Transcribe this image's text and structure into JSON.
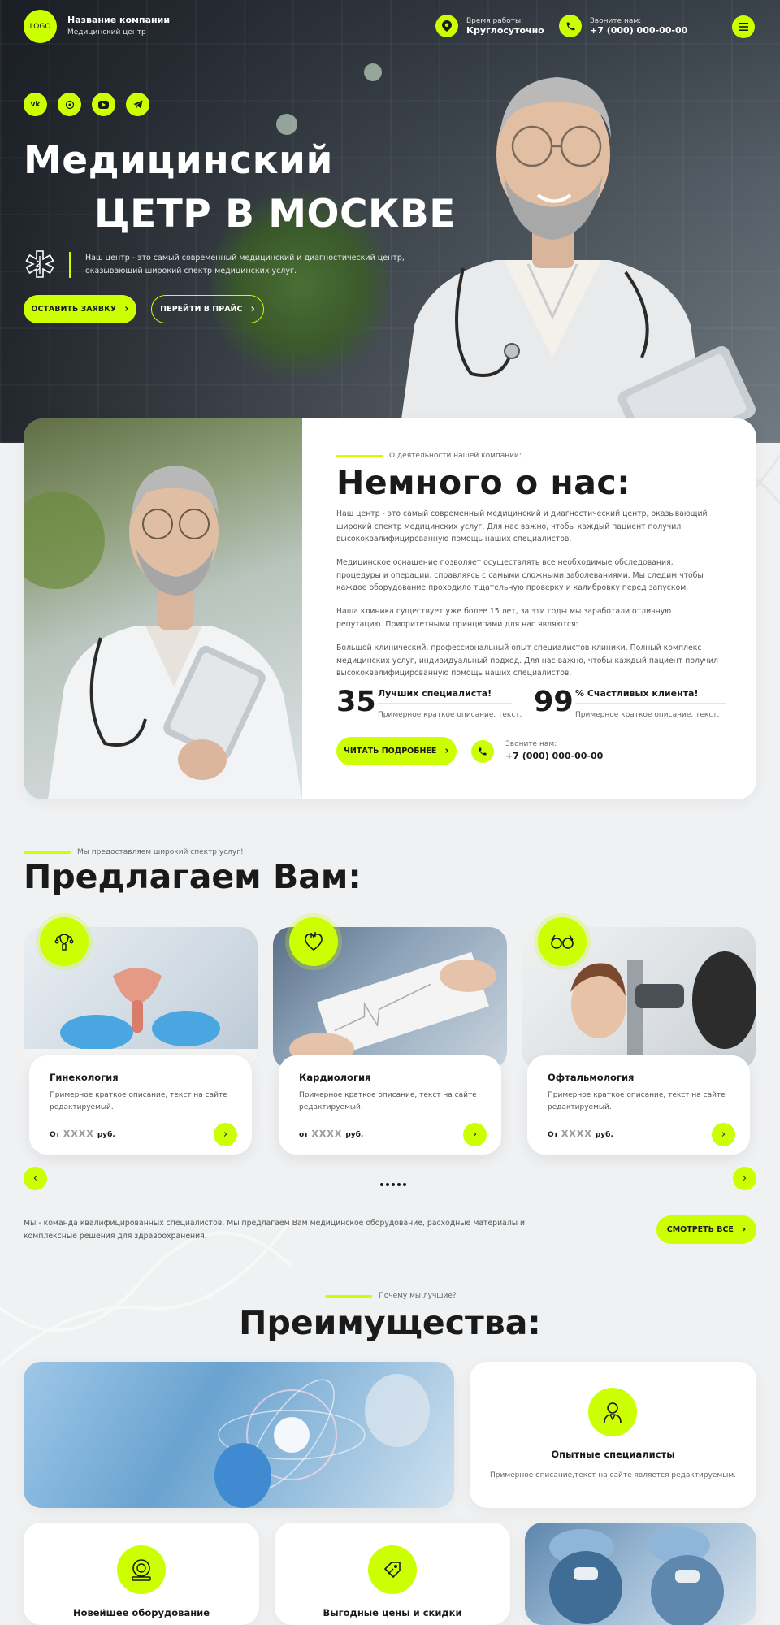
{
  "colors": {
    "accent": "#ccff00",
    "dark": "#1a1a1a",
    "bg": "#f0f1f2"
  },
  "header": {
    "logo": "LOGO",
    "company_name": "Название компании",
    "company_sub": "Медицинский центр",
    "hours_label": "Время работы:",
    "hours_value": "Круглосуточно",
    "phone_label": "Звоните нам:",
    "phone_value": "+7 (000) 000-00-00",
    "menu_icon": "menu-icon"
  },
  "social": [
    {
      "icon": "vk-icon",
      "label": "vk"
    },
    {
      "icon": "whatsapp-icon",
      "label": "wa"
    },
    {
      "icon": "youtube-icon",
      "label": "yt"
    },
    {
      "icon": "telegram-icon",
      "label": "tg"
    }
  ],
  "hero": {
    "title_line1": "Медицинский",
    "title_line2": "ЦЕТР В МОСКВЕ",
    "description": "Наш центр - это самый современный медицинский и диагностический центр, оказывающий широкий спектр медицинских услуг.",
    "btn_request": "ОСТАВИТЬ ЗАЯВКУ",
    "btn_price": "ПЕРЕЙТИ В ПРАЙС"
  },
  "about": {
    "kicker": "О деятельности нашей компании:",
    "title": "Немного о нас:",
    "p1": "Наш центр - это самый современный медицинский и диагностический центр, оказывающий широкий спектр медицинских услуг. Для нас важно, чтобы каждый пациент получил высококвалифицированную помощь наших специалистов.",
    "p2": "Медицинское оснащение позволяет осуществлять все необходимые обследования, процедуры и операции, справляясь с самыми сложными заболеваниями. Мы следим чтобы каждое оборудование проходило тщательную проверку и калибровку перед запуском.",
    "p3": "Наша клиника существует уже более 15 лет, за эти годы мы заработали отличную репутацию. Приоритетными принципами для нас являются:",
    "p4": "Большой клинический, профессиональный опыт специалистов клиники. Полный комплекс медицинских услуг, индивидуальный подход. Для нас важно, чтобы каждый пациент получил высококвалифицированную помощь наших специалистов.",
    "stats": [
      {
        "num": "35",
        "title": "Лучших специалиста!",
        "desc": "Примерное краткое описание, текст."
      },
      {
        "num": "99",
        "title": "% Счастливых клиента!",
        "desc": "Примерное краткое описание, текст."
      }
    ],
    "btn_more": "ЧИТАТЬ ПОДРОБНЕЕ",
    "phone_label": "Звоните нам:",
    "phone_value": "+7 (000) 000-00-00"
  },
  "services": {
    "kicker": "Мы предоставляем широкий спектр услуг!",
    "title": "Предлагаем Вам:",
    "items": [
      {
        "title": "Гинекология",
        "desc": "Примерное краткое описание, текст на сайте редактируемый.",
        "price_from": "От",
        "price": "XXXX",
        "currency": "руб.",
        "icon": "uterus-icon"
      },
      {
        "title": "Кардиология",
        "desc": "Примерное краткое описание, текст на сайте редактируемый.",
        "price_from": "от",
        "price": "XXXX",
        "currency": "руб.",
        "icon": "heart-icon"
      },
      {
        "title": "Офтальмология",
        "desc": "Примерное краткое описание, текст на сайте редактируемый.",
        "price_from": "От",
        "price": "XXXX",
        "currency": "руб.",
        "icon": "glasses-icon"
      }
    ],
    "footer_text": "Мы - команда квалифицированных специалистов. Мы предлагаем Вам медицинское оборудование, расходные материалы и комплексные решения для здравоохранения.",
    "btn_all": "СМОТРЕТЬ ВСЕ"
  },
  "advantages": {
    "kicker": "Почему мы лучшие?",
    "title": "Преимущества:",
    "items": [
      {
        "title": "Опытные специалисты",
        "desc": "Примерное описание,текст на сайте является редактируемым.",
        "icon": "doctor-icon"
      },
      {
        "title": "Новейшее оборудование",
        "icon": "mri-icon"
      },
      {
        "title": "Выгодные цены и скидки",
        "icon": "discount-icon"
      }
    ]
  }
}
